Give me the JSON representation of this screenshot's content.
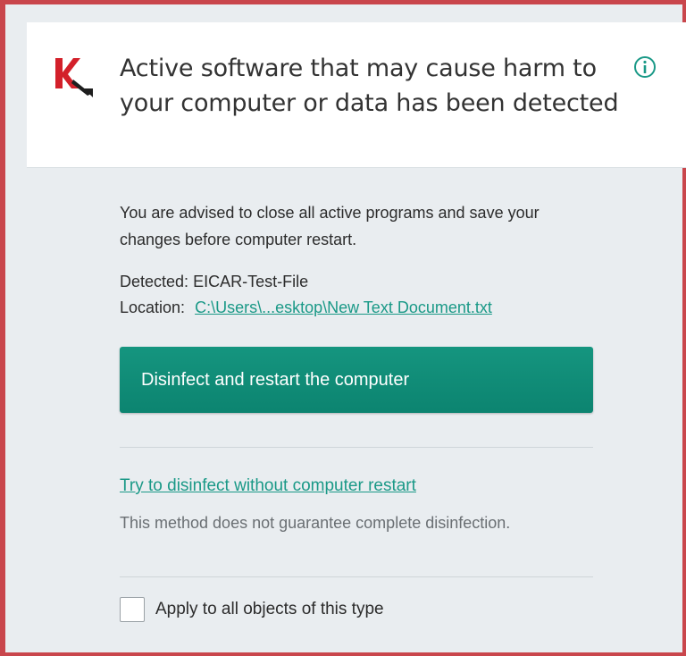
{
  "header": {
    "title": "Active software that may cause harm to your computer or data has been detected",
    "logo_icon": "kaspersky-logo-icon",
    "info_icon": "info-circle-icon"
  },
  "body": {
    "advice": "You are advised to close all active programs and save your changes before computer restart.",
    "detected_label": "Detected:",
    "detected_value": "EICAR-Test-File",
    "location_label": "Location:",
    "location_path": "C:\\Users\\...esktop\\New Text Document.txt"
  },
  "actions": {
    "primary_label": "Disinfect and restart the computer",
    "alt_link": "Try to disinfect without computer restart",
    "alt_note": "This method does not guarantee complete disinfection.",
    "apply_all_label": "Apply to all objects of this type",
    "apply_all_checked": false
  },
  "colors": {
    "accent": "#0c8c78",
    "link": "#1a9987",
    "frame_border": "#c9464c",
    "content_bg": "#e9edf0",
    "logo_red": "#d3202a"
  }
}
